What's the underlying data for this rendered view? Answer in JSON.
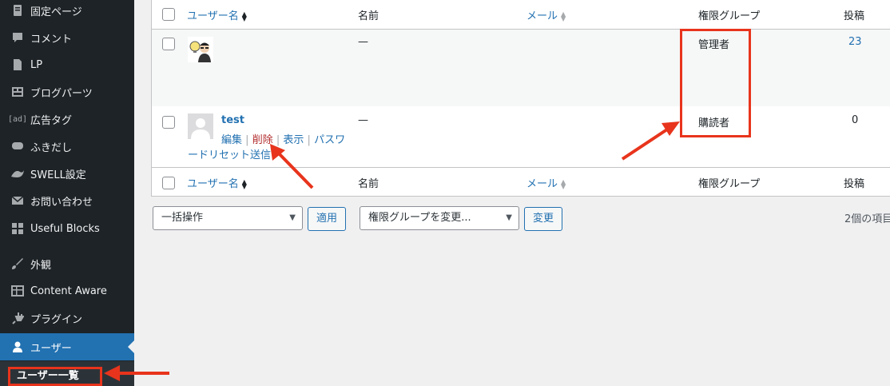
{
  "sidebar": {
    "items": [
      {
        "label": "固定ページ",
        "icon": "page-icon"
      },
      {
        "label": "コメント",
        "icon": "comment-icon"
      },
      {
        "label": "LP",
        "icon": "document-icon"
      },
      {
        "label": "ブログパーツ",
        "icon": "grid-icon"
      },
      {
        "label": "広告タグ",
        "icon": "ad-icon",
        "icon_text": "[ad]"
      },
      {
        "label": "ふきだし",
        "icon": "speech-bubble-icon"
      },
      {
        "label": "SWELL設定",
        "icon": "swell-icon"
      },
      {
        "label": "お問い合わせ",
        "icon": "mail-icon"
      },
      {
        "label": "Useful Blocks",
        "icon": "blocks-icon"
      },
      {
        "label": "外観",
        "icon": "brush-icon"
      },
      {
        "label": "Content Aware",
        "icon": "table-icon"
      },
      {
        "label": "プラグイン",
        "icon": "plugin-icon"
      },
      {
        "label": "ユーザー",
        "icon": "user-icon",
        "active": true
      }
    ],
    "submenu_item": "ユーザー一覧"
  },
  "table": {
    "columns": {
      "username": "ユーザー名",
      "name": "名前",
      "email": "メール",
      "role": "権限グループ",
      "posts": "投稿"
    },
    "rows": [
      {
        "username": "",
        "name": "—",
        "email": "",
        "role": "管理者",
        "posts": "23"
      },
      {
        "username": "test",
        "name": "—",
        "email": "",
        "role": "購読者",
        "posts": "0",
        "actions": {
          "edit": "編集",
          "delete": "削除",
          "view": "表示",
          "reset_a": "パスワ",
          "reset_b": "ードリセット送信"
        },
        "separator": "|"
      }
    ]
  },
  "bulk": {
    "bulk_action_select": "一括操作",
    "apply_button": "適用",
    "role_select": "権限グループを変更...",
    "change_button": "変更",
    "item_count": "2個の項目"
  },
  "colors": {
    "highlight": "#e8341c",
    "link": "#2271b1",
    "delete": "#b32d2e",
    "sidebar_bg": "#1d2327",
    "active_bg": "#2271b1"
  }
}
